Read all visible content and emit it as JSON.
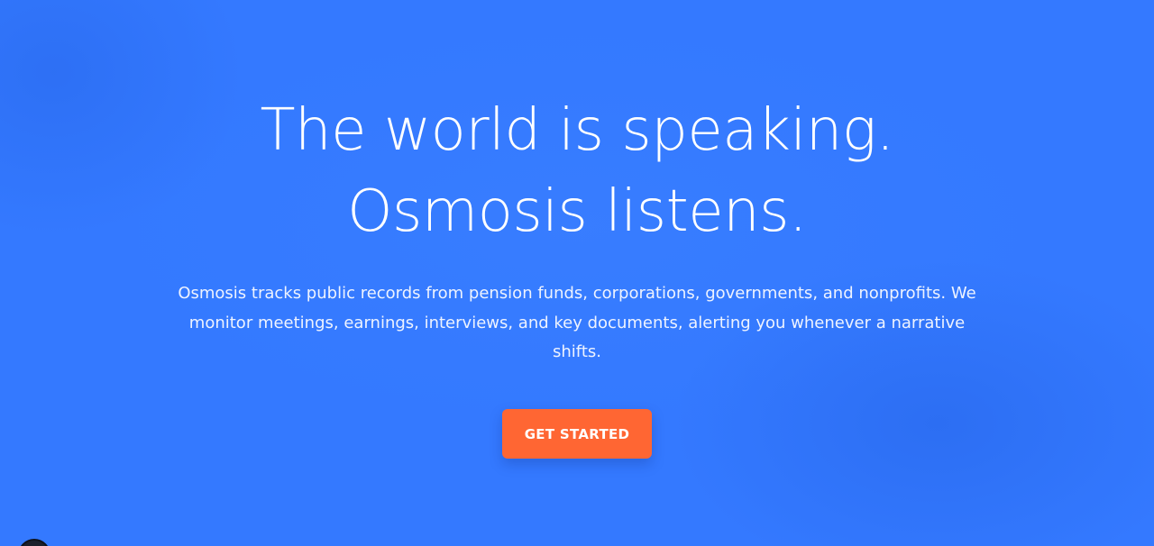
{
  "hero": {
    "headline_line1": "The world is speaking.",
    "headline_line2": "Osmosis listens.",
    "description": "Osmosis tracks public records from pension funds, corporations, governments, and nonprofits. We monitor meetings, earnings, interviews, and key documents, alerting you whenever a narrative shifts.",
    "cta_label": "GET STARTED"
  },
  "colors": {
    "background": "#3479ff",
    "cta": "#ff6633",
    "text": "#ffffff"
  },
  "icons": {
    "corner_badge": "chat-launcher-icon"
  }
}
